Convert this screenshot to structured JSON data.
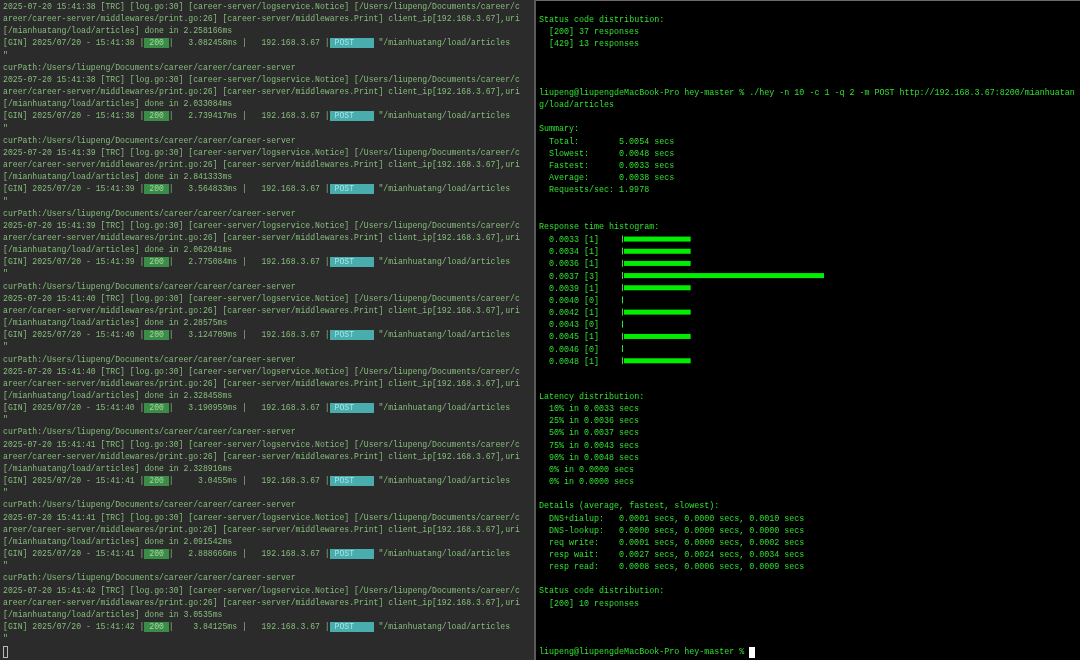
{
  "server_log": {
    "separator": "|",
    "entries": [
      {
        "log_lines": [
          "2025-07-20 15:41:38 [TRC] [log.go:30] [career-server/logservice.Notice] [/Users/liupeng/Documents/career/c",
          "areer/career-server/middlewares/print.go:26] [career-server/middlewares.Print] client_ip[192.168.3.67],uri",
          "[/mianhuatang/load/articles] done in 2.258166ms"
        ],
        "gin": {
          "prefix": "[GIN] 2025/07/20 - 15:41:38",
          "status": "200",
          "latency": "3.082458ms",
          "client_ip": "192.168.3.67",
          "method": "POST",
          "path": "\"/mianhuatang/load/articles"
        },
        "closing": "\""
      },
      {
        "cur_path": "curPath:/Users/liupeng/Documents/career/career/career-server",
        "log_lines": [
          "2025-07-20 15:41:38 [TRC] [log.go:30] [career-server/logservice.Notice] [/Users/liupeng/Documents/career/c",
          "areer/career-server/middlewares/print.go:26] [career-server/middlewares.Print] client_ip[192.168.3.67],uri",
          "[/mianhuatang/load/articles] done in 2.033084ms"
        ],
        "gin": {
          "prefix": "[GIN] 2025/07/20 - 15:41:38",
          "status": "200",
          "latency": "2.739417ms",
          "client_ip": "192.168.3.67",
          "method": "POST",
          "path": "\"/mianhuatang/load/articles"
        },
        "closing": "\""
      },
      {
        "cur_path": "curPath:/Users/liupeng/Documents/career/career/career-server",
        "log_lines": [
          "2025-07-20 15:41:39 [TRC] [log.go:30] [career-server/logservice.Notice] [/Users/liupeng/Documents/career/c",
          "areer/career-server/middlewares/print.go:26] [career-server/middlewares.Print] client_ip[192.168.3.67],uri",
          "[/mianhuatang/load/articles] done in 2.841333ms"
        ],
        "gin": {
          "prefix": "[GIN] 2025/07/20 - 15:41:39",
          "status": "200",
          "latency": "3.564833ms",
          "client_ip": "192.168.3.67",
          "method": "POST",
          "path": "\"/mianhuatang/load/articles"
        },
        "closing": "\""
      },
      {
        "cur_path": "curPath:/Users/liupeng/Documents/career/career/career-server",
        "log_lines": [
          "2025-07-20 15:41:39 [TRC] [log.go:30] [career-server/logservice.Notice] [/Users/liupeng/Documents/career/c",
          "areer/career-server/middlewares/print.go:26] [career-server/middlewares.Print] client_ip[192.168.3.67],uri",
          "[/mianhuatang/load/articles] done in 2.062041ms"
        ],
        "gin": {
          "prefix": "[GIN] 2025/07/20 - 15:41:39",
          "status": "200",
          "latency": "2.775084ms",
          "client_ip": "192.168.3.67",
          "method": "POST",
          "path": "\"/mianhuatang/load/articles"
        },
        "closing": "\""
      },
      {
        "cur_path": "curPath:/Users/liupeng/Documents/career/career/career-server",
        "log_lines": [
          "2025-07-20 15:41:40 [TRC] [log.go:30] [career-server/logservice.Notice] [/Users/liupeng/Documents/career/c",
          "areer/career-server/middlewares/print.go:26] [career-server/middlewares.Print] client_ip[192.168.3.67],uri",
          "[/mianhuatang/load/articles] done in 2.28575ms"
        ],
        "gin": {
          "prefix": "[GIN] 2025/07/20 - 15:41:40",
          "status": "200",
          "latency": "3.124709ms",
          "client_ip": "192.168.3.67",
          "method": "POST",
          "path": "\"/mianhuatang/load/articles"
        },
        "closing": "\""
      },
      {
        "cur_path": "curPath:/Users/liupeng/Documents/career/career/career-server",
        "log_lines": [
          "2025-07-20 15:41:40 [TRC] [log.go:30] [career-server/logservice.Notice] [/Users/liupeng/Documents/career/c",
          "areer/career-server/middlewares/print.go:26] [career-server/middlewares.Print] client_ip[192.168.3.67],uri",
          "[/mianhuatang/load/articles] done in 2.328458ms"
        ],
        "gin": {
          "prefix": "[GIN] 2025/07/20 - 15:41:40",
          "status": "200",
          "latency": "3.190959ms",
          "client_ip": "192.168.3.67",
          "method": "POST",
          "path": "\"/mianhuatang/load/articles"
        },
        "closing": "\""
      },
      {
        "cur_path": "curPath:/Users/liupeng/Documents/career/career/career-server",
        "log_lines": [
          "2025-07-20 15:41:41 [TRC] [log.go:30] [career-server/logservice.Notice] [/Users/liupeng/Documents/career/c",
          "areer/career-server/middlewares/print.go:26] [career-server/middlewares.Print] client_ip[192.168.3.67],uri",
          "[/mianhuatang/load/articles] done in 2.328916ms"
        ],
        "gin": {
          "prefix": "[GIN] 2025/07/20 - 15:41:41",
          "status": "200",
          "latency": "3.0455ms",
          "client_ip": "192.168.3.67",
          "method": "POST",
          "path": "\"/mianhuatang/load/articles"
        },
        "closing": "\""
      },
      {
        "cur_path": "curPath:/Users/liupeng/Documents/career/career/career-server",
        "log_lines": [
          "2025-07-20 15:41:41 [TRC] [log.go:30] [career-server/logservice.Notice] [/Users/liupeng/Documents/career/c",
          "areer/career-server/middlewares/print.go:26] [career-server/middlewares.Print] client_ip[192.168.3.67],uri",
          "[/mianhuatang/load/articles] done in 2.091542ms"
        ],
        "gin": {
          "prefix": "[GIN] 2025/07/20 - 15:41:41",
          "status": "200",
          "latency": "2.888666ms",
          "client_ip": "192.168.3.67",
          "method": "POST",
          "path": "\"/mianhuatang/load/articles"
        },
        "closing": "\""
      },
      {
        "cur_path": "curPath:/Users/liupeng/Documents/career/career/career-server",
        "log_lines": [
          "2025-07-20 15:41:42 [TRC] [log.go:30] [career-server/logservice.Notice] [/Users/liupeng/Documents/career/c",
          "areer/career-server/middlewares/print.go:26] [career-server/middlewares.Print] client_ip[192.168.3.67],uri",
          "[/mianhuatang/load/articles] done in 3.0535ms"
        ],
        "gin": {
          "prefix": "[GIN] 2025/07/20 - 15:41:42",
          "status": "200",
          "latency": "3.84125ms",
          "client_ip": "192.168.3.67",
          "method": "POST",
          "path": "\"/mianhuatang/load/articles"
        },
        "closing": "\""
      }
    ]
  },
  "load_test": {
    "lines": [
      {
        "kind": "heading",
        "text": "Status code distribution:"
      },
      {
        "kind": "item",
        "text": "[200] 37 responses"
      },
      {
        "kind": "item",
        "text": "[429] 13 responses"
      },
      {
        "kind": "blank"
      },
      {
        "kind": "blank"
      },
      {
        "kind": "blank"
      },
      {
        "kind": "command",
        "text": "liupeng@liupengdeMacBook-Pro hey-master % ./hey -n 10 -c 1 -q 2 -m POST http://192.168.3.67:8200/mianhuatan"
      },
      {
        "kind": "command",
        "text": "g/load/articles"
      },
      {
        "kind": "blank"
      },
      {
        "kind": "heading",
        "text": "Summary:"
      },
      {
        "kind": "item",
        "text": "Total:        5.0054 secs"
      },
      {
        "kind": "item",
        "text": "Slowest:      0.0048 secs"
      },
      {
        "kind": "item",
        "text": "Fastest:      0.0033 secs"
      },
      {
        "kind": "item",
        "text": "Average:      0.0038 secs"
      },
      {
        "kind": "item",
        "text": "Requests/sec: 1.9978"
      },
      {
        "kind": "blank"
      },
      {
        "kind": "blank"
      },
      {
        "kind": "heading",
        "text": "Response time histogram:"
      },
      {
        "kind": "histogram",
        "chart_data": {
          "type": "bar",
          "orientation": "horizontal",
          "categories": [
            "0.0033",
            "0.0034",
            "0.0036",
            "0.0037",
            "0.0039",
            "0.0040",
            "0.0042",
            "0.0043",
            "0.0045",
            "0.0046",
            "0.0048"
          ],
          "value_labels": [
            "[1]",
            "[1]",
            "[1]",
            "[3]",
            "[1]",
            "[0]",
            "[1]",
            "[0]",
            "[1]",
            "[0]",
            "[1]"
          ],
          "values": [
            1,
            1,
            1,
            3,
            1,
            0,
            1,
            0,
            1,
            0,
            1
          ]
        }
      },
      {
        "kind": "blank"
      },
      {
        "kind": "blank"
      },
      {
        "kind": "heading",
        "text": "Latency distribution:"
      },
      {
        "kind": "item",
        "text": "10% in 0.0033 secs"
      },
      {
        "kind": "item",
        "text": "25% in 0.0036 secs"
      },
      {
        "kind": "item",
        "text": "50% in 0.0037 secs"
      },
      {
        "kind": "item",
        "text": "75% in 0.0043 secs"
      },
      {
        "kind": "item",
        "text": "90% in 0.0048 secs"
      },
      {
        "kind": "item",
        "text": "0% in 0.0000 secs"
      },
      {
        "kind": "item",
        "text": "0% in 0.0000 secs"
      },
      {
        "kind": "blank"
      },
      {
        "kind": "heading",
        "text": "Details (average, fastest, slowest):"
      },
      {
        "kind": "item",
        "text": "DNS+dialup:   0.0001 secs, 0.0000 secs, 0.0010 secs"
      },
      {
        "kind": "item",
        "text": "DNS-lookup:   0.0000 secs, 0.0000 secs, 0.0000 secs"
      },
      {
        "kind": "item",
        "text": "req write:    0.0001 secs, 0.0000 secs, 0.0002 secs"
      },
      {
        "kind": "item",
        "text": "resp wait:    0.0027 secs, 0.0024 secs, 0.0034 secs"
      },
      {
        "kind": "item",
        "text": "resp read:    0.0008 secs, 0.0006 secs, 0.0009 secs"
      },
      {
        "kind": "blank"
      },
      {
        "kind": "heading",
        "text": "Status code distribution:"
      },
      {
        "kind": "item",
        "text": "[200] 10 responses"
      },
      {
        "kind": "blank"
      },
      {
        "kind": "blank"
      },
      {
        "kind": "blank"
      },
      {
        "kind": "prompt",
        "text": "liupeng@liupengdeMacBook-Pro hey-master %"
      }
    ]
  }
}
